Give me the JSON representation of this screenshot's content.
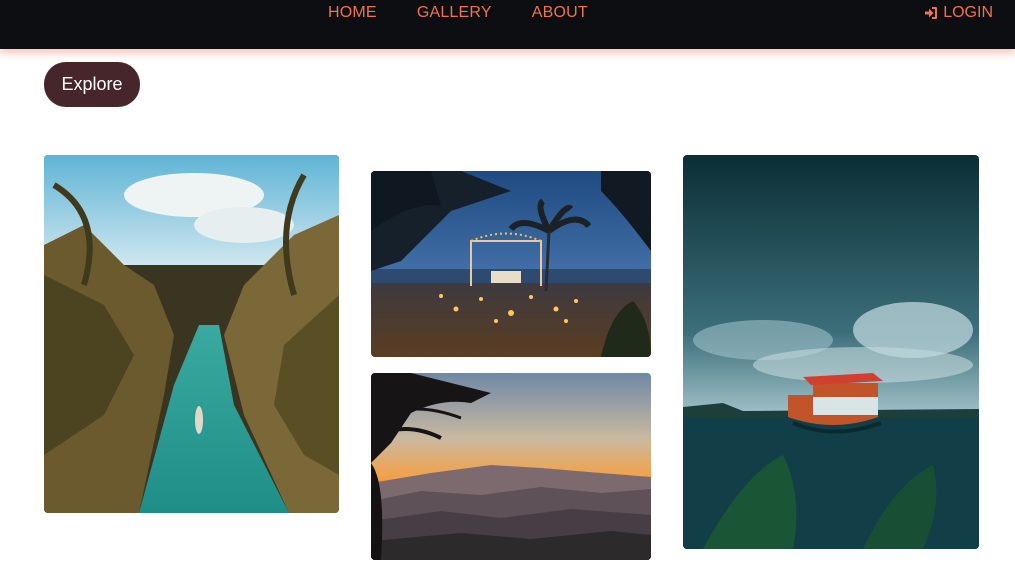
{
  "nav": {
    "links": [
      {
        "label": "HOME"
      },
      {
        "label": "GALLERY"
      },
      {
        "label": "ABOUT"
      }
    ],
    "login_label": "LOGIN",
    "login_icon": "sign-in-icon",
    "link_color": "#f0734d",
    "bg_color": "#0d0e12"
  },
  "explore": {
    "label": "Explore",
    "bg_color": "#47262b"
  },
  "gallery": {
    "photos": [
      {
        "subject": "tropical-river-palms"
      },
      {
        "subject": "beach-dinner-candles"
      },
      {
        "subject": "mountain-sunset"
      },
      {
        "subject": "boat-on-lake"
      }
    ]
  }
}
